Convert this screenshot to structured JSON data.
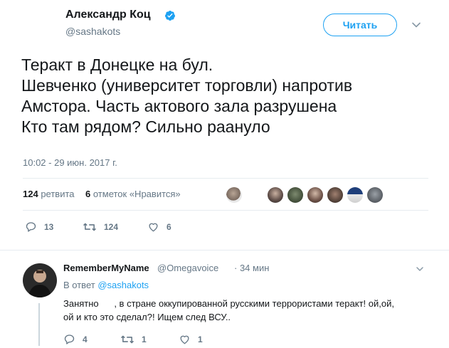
{
  "tweet": {
    "author_name": "Александр Коц",
    "author_handle": "@sashakots",
    "follow_label": "Читать",
    "text_lines": [
      "Теракт в Донецке на бул.",
      "Шевченко (университет торговли) напротив",
      "Амстора. Часть актового зала разрушена",
      "Кто там рядом? Сильно раануло"
    ],
    "timestamp": "10:02 - 29 июн. 2017 г.",
    "stats": {
      "retweets_count": "124",
      "retweets_label": "ретвита",
      "likes_count": "6",
      "likes_label": "отметок «Нравится»"
    },
    "actions": {
      "reply_count": "13",
      "retweet_count": "124",
      "like_count": "6"
    }
  },
  "reply": {
    "author_name": "RememberMyName",
    "author_handle": "@Omegavoice",
    "time": "· 34 мин",
    "in_reply_prefix": "В ответ",
    "in_reply_handle": "@sashakots",
    "text_lines": [
      "Занятно      , в стране оккупированной русскими террористами теракт! ой,ой,",
      "ой и кто это сделал?! Ищем след ВСУ.."
    ],
    "actions": {
      "reply_count": "4",
      "retweet_count": "1",
      "like_count": "1"
    }
  },
  "colors": {
    "accent": "#1da1f2",
    "text": "#14171a",
    "muted": "#657786",
    "border": "#e6ecf0"
  },
  "icons": {
    "verified": "verified-badge-icon",
    "chevron": "chevron-down-icon",
    "reply": "reply-icon",
    "retweet": "retweet-icon",
    "like": "heart-icon"
  }
}
